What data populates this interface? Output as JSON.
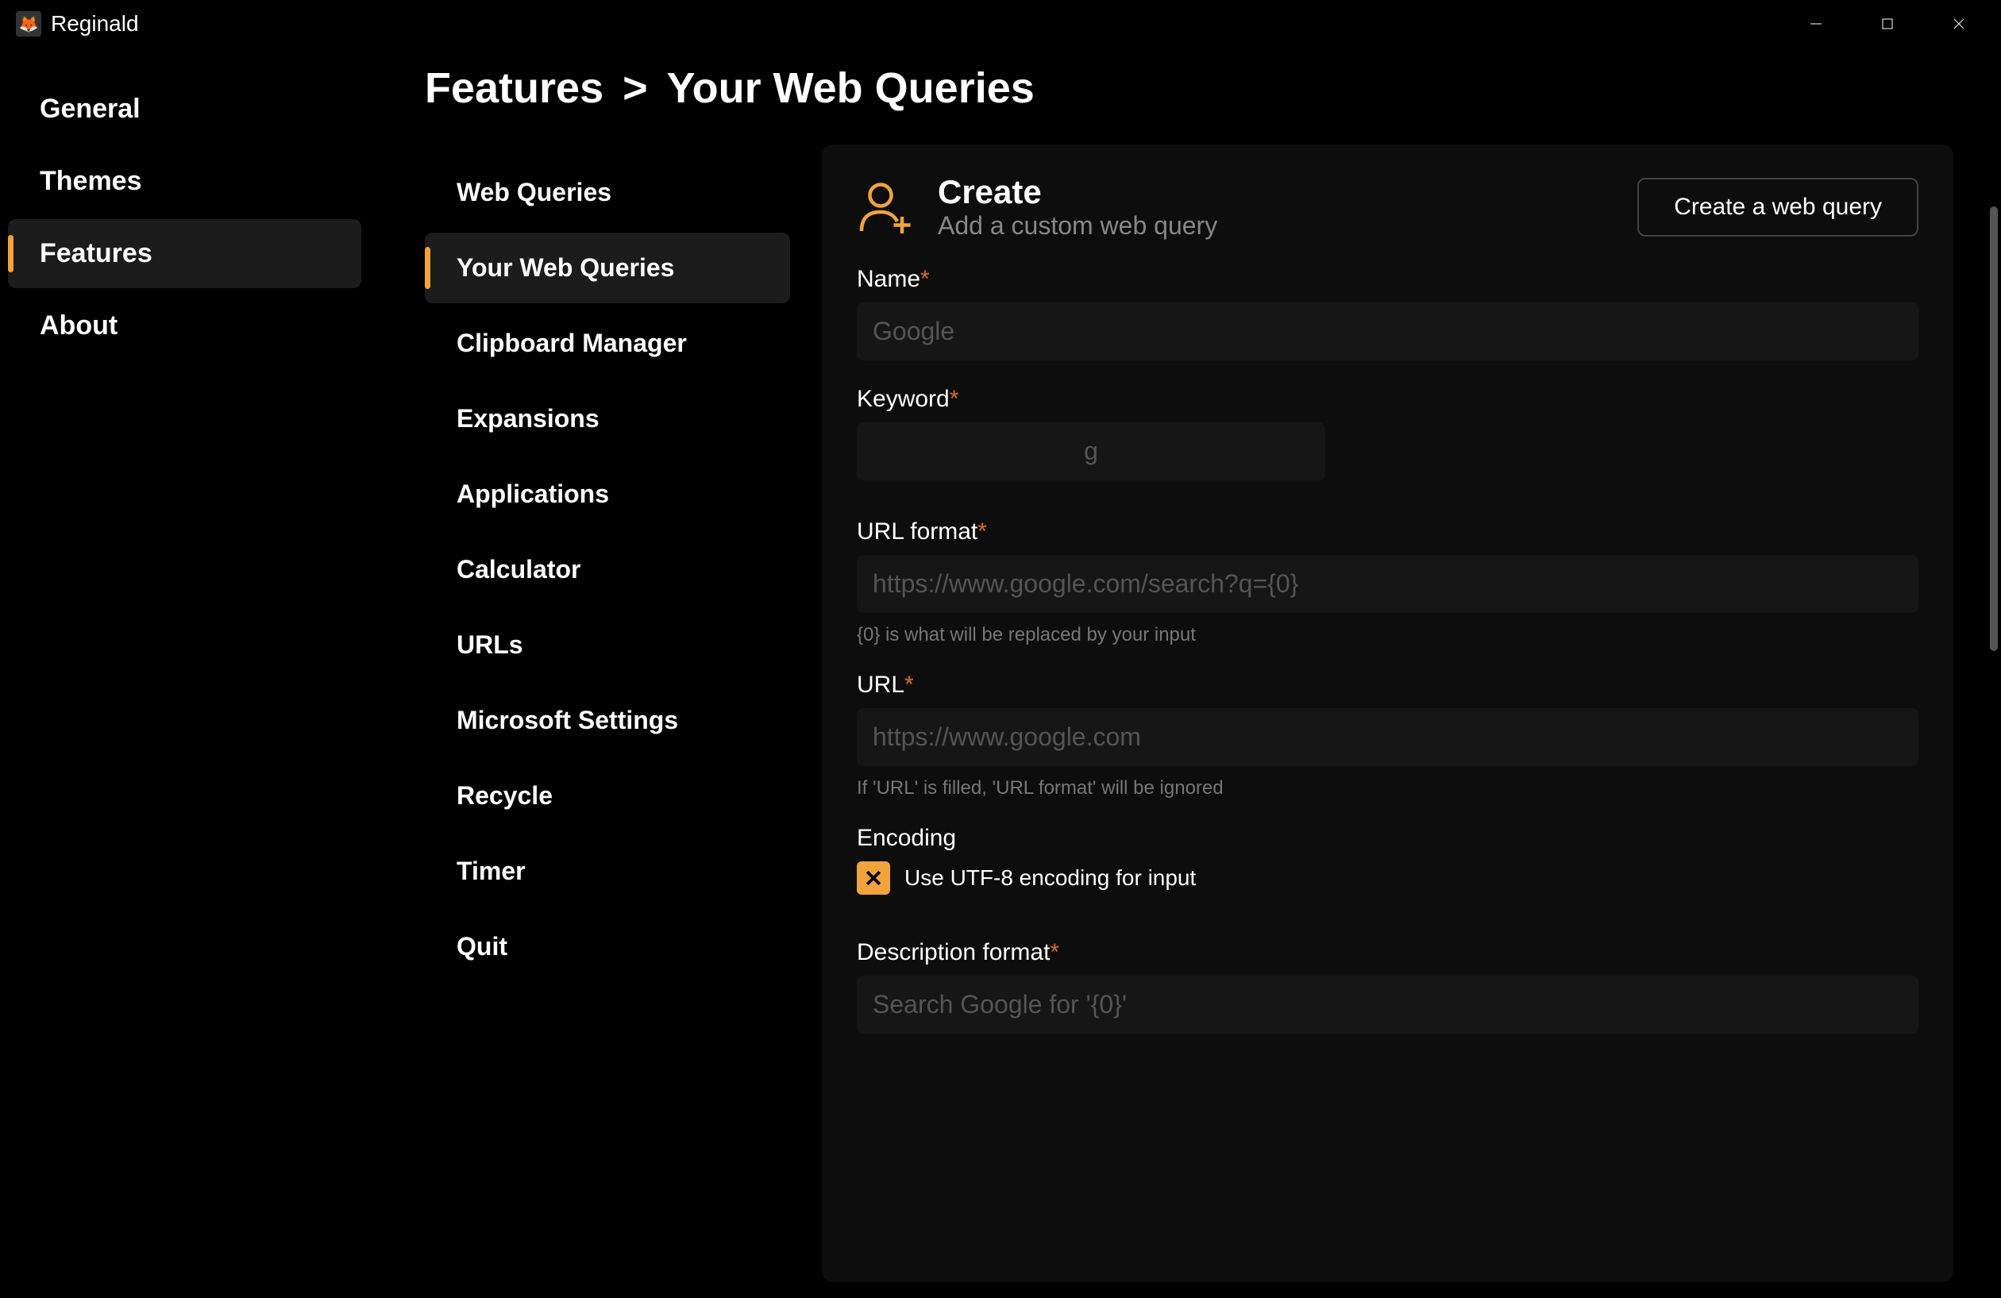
{
  "app": {
    "title": "Reginald"
  },
  "window_controls": {
    "min": "minimize",
    "max": "maximize",
    "close": "close"
  },
  "sidebar": {
    "items": [
      {
        "label": "General",
        "active": false
      },
      {
        "label": "Themes",
        "active": false
      },
      {
        "label": "Features",
        "active": true
      },
      {
        "label": "About",
        "active": false
      }
    ]
  },
  "breadcrumb": {
    "parent": "Features",
    "sep": ">",
    "current": "Your Web Queries"
  },
  "sub_sidebar": {
    "items": [
      {
        "label": "Web Queries",
        "active": false
      },
      {
        "label": "Your Web Queries",
        "active": true
      },
      {
        "label": "Clipboard Manager",
        "active": false
      },
      {
        "label": "Expansions",
        "active": false
      },
      {
        "label": "Applications",
        "active": false
      },
      {
        "label": "Calculator",
        "active": false
      },
      {
        "label": "URLs",
        "active": false
      },
      {
        "label": "Microsoft Settings",
        "active": false
      },
      {
        "label": "Recycle",
        "active": false
      },
      {
        "label": "Timer",
        "active": false
      },
      {
        "label": "Quit",
        "active": false
      }
    ]
  },
  "panel": {
    "title": "Create",
    "subtitle": "Add a custom web query",
    "action_label": "Create a web query",
    "fields": {
      "name": {
        "label": "Name",
        "required": true,
        "placeholder": "Google",
        "value": ""
      },
      "keyword": {
        "label": "Keyword",
        "required": true,
        "placeholder": "g",
        "value": ""
      },
      "url_format": {
        "label": "URL format",
        "required": true,
        "placeholder": "https://www.google.com/search?q={0}",
        "value": "",
        "hint": "{0} is what will be replaced by your input"
      },
      "url": {
        "label": "URL",
        "required": true,
        "placeholder": "https://www.google.com",
        "value": "",
        "hint": "If 'URL' is filled, 'URL format' will be ignored"
      },
      "encoding": {
        "label": "Encoding",
        "checkbox_label": "Use UTF-8 encoding for input",
        "checked": true
      },
      "description_format": {
        "label": "Description format",
        "required": true,
        "placeholder": "Search Google for '{0}'",
        "value": ""
      }
    }
  },
  "colors": {
    "accent": "#f2a33c"
  }
}
